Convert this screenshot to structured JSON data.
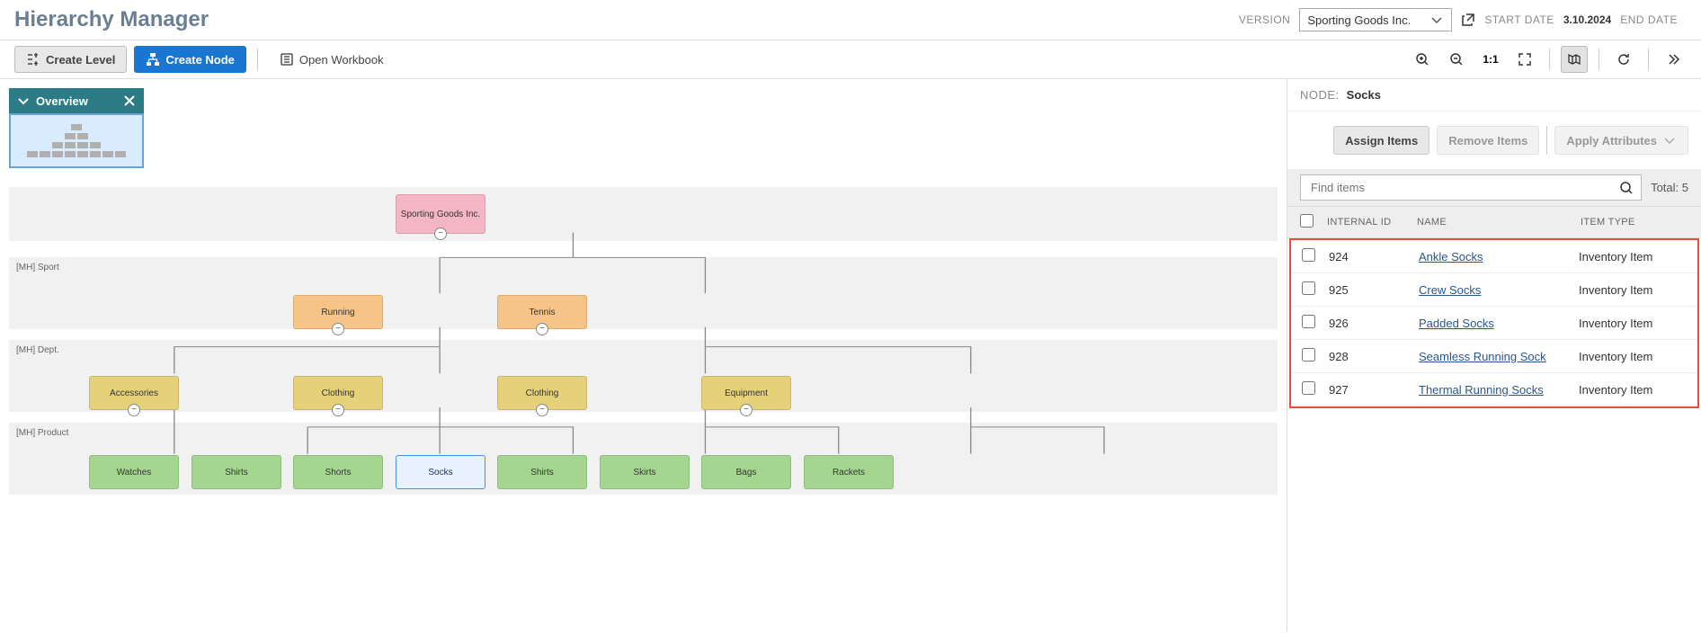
{
  "header": {
    "title": "Hierarchy Manager",
    "versionLabel": "VERSION",
    "versionValue": "Sporting Goods Inc.",
    "startDateLabel": "START DATE",
    "startDateValue": "3.10.2024",
    "endDateLabel": "END DATE",
    "endDateValue": ""
  },
  "toolbar": {
    "createLevel": "Create Level",
    "createNode": "Create Node",
    "openWorkbook": "Open Workbook"
  },
  "overview": {
    "title": "Overview"
  },
  "levels": {
    "sport": "[MH] Sport",
    "dept": "[MH] Dept.",
    "product": "[MH] Product"
  },
  "nodes": {
    "root": "Sporting Goods Inc.",
    "running": "Running",
    "tennis": "Tennis",
    "accessories": "Accessories",
    "clothing1": "Clothing",
    "clothing2": "Clothing",
    "equipment": "Equipment",
    "watches": "Watches",
    "shirts1": "Shirts",
    "shorts": "Shorts",
    "socks": "Socks",
    "shirts2": "Shirts",
    "skirts": "Skirts",
    "bags": "Bags",
    "rackets": "Rackets"
  },
  "sidePanel": {
    "nodeLabel": "NODE:",
    "nodeValue": "Socks",
    "assignItems": "Assign Items",
    "removeItems": "Remove Items",
    "applyAttributes": "Apply Attributes",
    "searchPlaceholder": "Find items",
    "totalLabel": "Total:",
    "totalValue": "5",
    "columns": {
      "id": "INTERNAL ID",
      "name": "NAME",
      "type": "ITEM TYPE"
    },
    "rows": [
      {
        "id": "924",
        "name": "Ankle Socks",
        "type": "Inventory Item"
      },
      {
        "id": "925",
        "name": "Crew Socks",
        "type": "Inventory Item"
      },
      {
        "id": "926",
        "name": "Padded Socks",
        "type": "Inventory Item"
      },
      {
        "id": "928",
        "name": "Seamless Running Sock",
        "type": "Inventory Item"
      },
      {
        "id": "927",
        "name": "Thermal Running Socks",
        "type": "Inventory Item"
      }
    ]
  }
}
